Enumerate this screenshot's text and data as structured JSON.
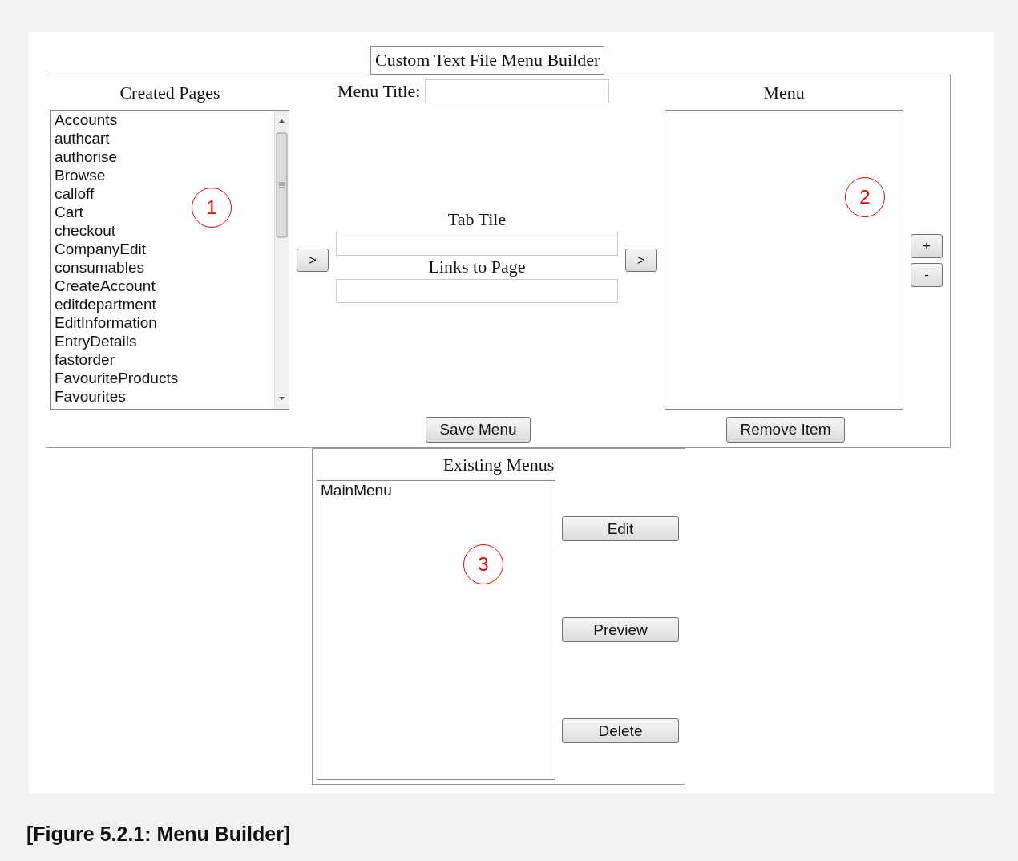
{
  "title": "Custom Text File Menu Builder",
  "created_pages": {
    "heading": "Created Pages",
    "items": [
      "Accounts",
      "authcart",
      "authorise",
      "Browse",
      "calloff",
      "Cart",
      "checkout",
      "CompanyEdit",
      "consumables",
      "CreateAccount",
      "editdepartment",
      "EditInformation",
      "EntryDetails",
      "fastorder",
      "FavouriteProducts",
      "Favourites"
    ]
  },
  "add_page_button": ">",
  "menu_title": {
    "label": "Menu Title:"
  },
  "tab_title": {
    "label": "Tab Tile"
  },
  "links_to_page": {
    "label": "Links to Page"
  },
  "add_item_button": ">",
  "menu": {
    "heading": "Menu"
  },
  "plus_button": "+",
  "minus_button": "-",
  "save_button": "Save Menu",
  "remove_button": "Remove Item",
  "existing_menus": {
    "heading": "Existing Menus",
    "items": [
      "MainMenu"
    ],
    "buttons": [
      "Edit",
      "Preview",
      "Delete"
    ]
  },
  "annotations": [
    "1",
    "2",
    "3"
  ],
  "caption": "[Figure 5.2.1: Menu Builder]"
}
